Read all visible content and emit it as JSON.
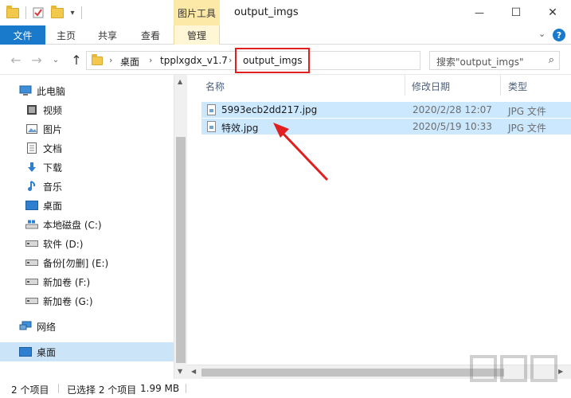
{
  "window": {
    "title": "output_imgs",
    "context_tab_group": "图片工具",
    "controls": {
      "minimize": "—",
      "maximize": "☐",
      "close": "✕"
    }
  },
  "ribbon": {
    "file_tab": "文件",
    "tabs": [
      "主页",
      "共享",
      "查看"
    ],
    "context_tab": "管理",
    "help": "?",
    "accent": "#1979ca"
  },
  "address": {
    "crumbs": [
      "桌面",
      "tpplxgdx_v1.7",
      "output_imgs"
    ],
    "separator": "›",
    "search_placeholder": "搜索\"output_imgs\""
  },
  "nav_pane": {
    "items": [
      {
        "label": "此电脑",
        "icon": "computer-icon",
        "level": 0
      },
      {
        "label": "视频",
        "icon": "video-icon",
        "level": 1
      },
      {
        "label": "图片",
        "icon": "picture-icon",
        "level": 1
      },
      {
        "label": "文档",
        "icon": "document-icon",
        "level": 1
      },
      {
        "label": "下载",
        "icon": "download-icon",
        "level": 1
      },
      {
        "label": "音乐",
        "icon": "music-icon",
        "level": 1
      },
      {
        "label": "桌面",
        "icon": "desktop-icon",
        "level": 1
      },
      {
        "label": "本地磁盘 (C:)",
        "icon": "system-drive-icon",
        "level": 1
      },
      {
        "label": "软件 (D:)",
        "icon": "drive-icon",
        "level": 1
      },
      {
        "label": "备份[勿删] (E:)",
        "icon": "drive-icon",
        "level": 1
      },
      {
        "label": "新加卷 (F:)",
        "icon": "drive-icon",
        "level": 1
      },
      {
        "label": "新加卷 (G:)",
        "icon": "drive-icon",
        "level": 1
      },
      {
        "label": "网络",
        "icon": "network-icon",
        "level": 0
      },
      {
        "label": "桌面",
        "icon": "desktop-icon",
        "level": 0,
        "selected": true
      }
    ]
  },
  "file_list": {
    "columns": [
      "名称",
      "修改日期",
      "类型"
    ],
    "rows": [
      {
        "name": "5993ecb2dd217.jpg",
        "date": "2020/2/28 12:07",
        "type": "JPG 文件"
      },
      {
        "name": "特效.jpg",
        "date": "2020/5/19 10:33",
        "type": "JPG 文件"
      }
    ],
    "selection_color": "#cce8ff"
  },
  "status": {
    "count": "2 个项目",
    "selected": "已选择 2 个项目",
    "size": "1.99 MB"
  },
  "annotation_color": "#e02020"
}
